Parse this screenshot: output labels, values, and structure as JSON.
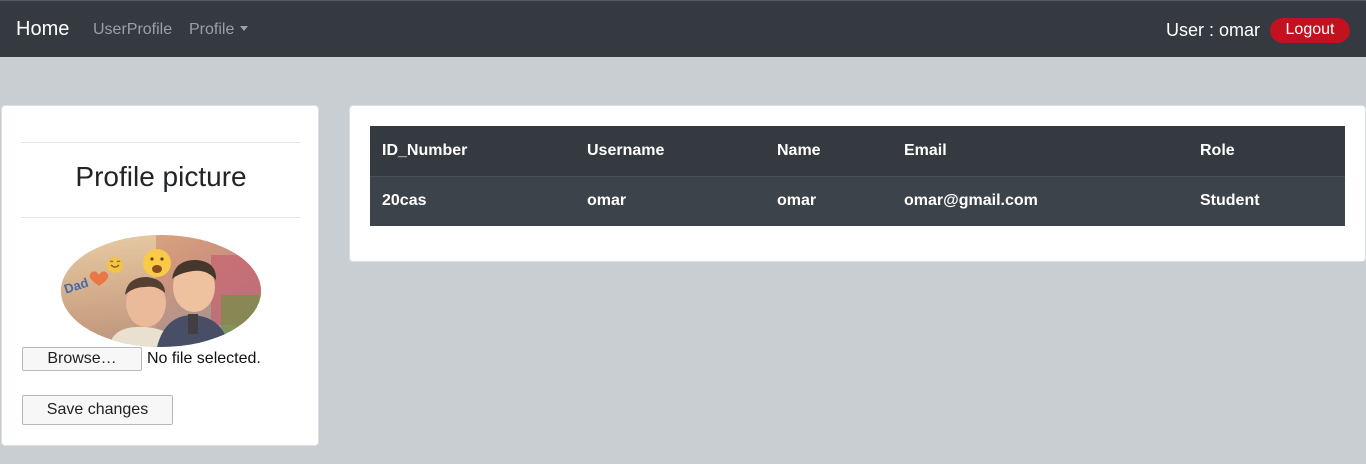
{
  "navbar": {
    "brand": "Home",
    "links": [
      "UserProfile",
      "Profile"
    ],
    "user_label": "User : omar",
    "logout_label": "Logout"
  },
  "profile_card": {
    "title": "Profile picture",
    "browse_label": "Browse…",
    "file_status": "No file selected.",
    "save_label": "Save changes"
  },
  "table": {
    "headers": [
      "ID_Number",
      "Username",
      "Name",
      "Email",
      "Role"
    ],
    "rows": [
      [
        "20cas",
        "omar",
        "omar",
        "omar@gmail.com",
        "Student"
      ]
    ]
  },
  "colors": {
    "navbar_bg": "#343a40",
    "page_bg": "#c9ced2",
    "logout_bg": "#c0121f",
    "table_head_bg": "#343a40",
    "table_row_bg": "#3d434a"
  }
}
